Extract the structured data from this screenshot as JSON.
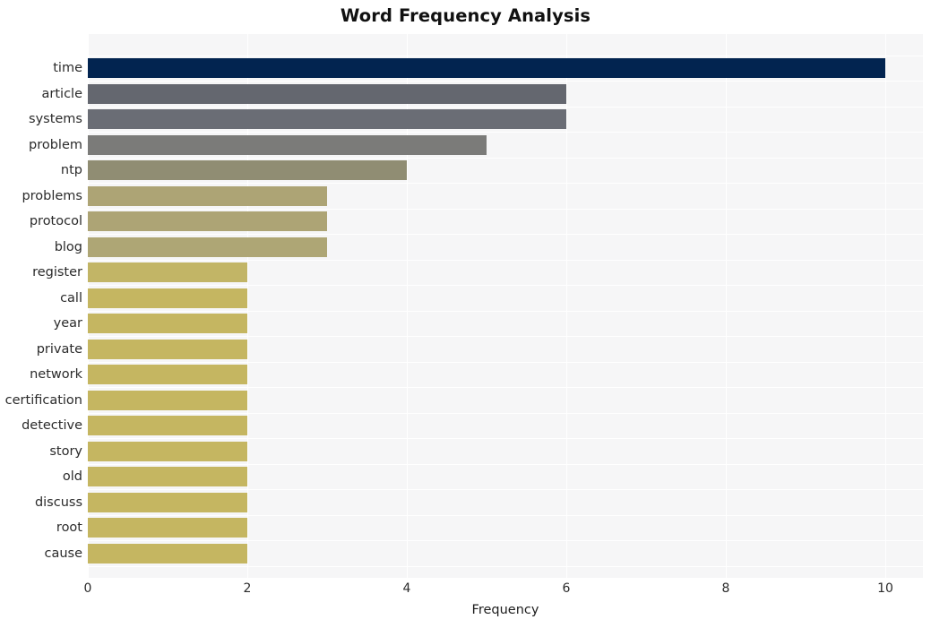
{
  "chart_data": {
    "type": "bar",
    "orientation": "horizontal",
    "title": "Word Frequency Analysis",
    "xlabel": "Frequency",
    "ylabel": "",
    "xlim": [
      0,
      10.5
    ],
    "xticks": [
      0,
      2,
      4,
      6,
      8,
      10
    ],
    "xtick_labels": [
      "0",
      "2",
      "4",
      "6",
      "8",
      "10"
    ],
    "grid": true,
    "legend": null,
    "categories": [
      "time",
      "article",
      "systems",
      "problem",
      "ntp",
      "problems",
      "protocol",
      "blog",
      "register",
      "call",
      "year",
      "private",
      "network",
      "certification",
      "detective",
      "story",
      "old",
      "discuss",
      "root",
      "cause"
    ],
    "values": [
      10,
      6,
      6,
      5,
      4,
      3,
      3,
      3,
      2,
      2,
      2,
      2,
      2,
      2,
      2,
      2,
      2,
      2,
      2,
      2
    ],
    "bar_colors": [
      "#022450",
      "#64676f",
      "#6a6d75",
      "#7b7b79",
      "#908d73",
      "#ada475",
      "#ada475",
      "#aea675",
      "#c2b566",
      "#c5b661",
      "#c5b661",
      "#c5b661",
      "#c5b661",
      "#c5b661",
      "#c5b661",
      "#c5b661",
      "#c5b661",
      "#c5b661",
      "#c5b661",
      "#c5b661"
    ],
    "plot_background": "#f6f6f7",
    "gridline_color": "#ffffff",
    "figure_background": "#ffffff"
  }
}
